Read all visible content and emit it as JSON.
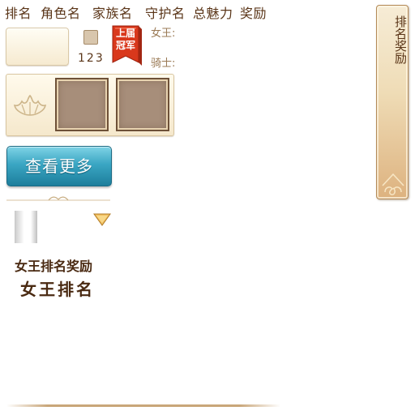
{
  "header": {
    "col_rank": "排名",
    "col_role": "角色名",
    "col_family": "家族名",
    "col_guard": "守护名",
    "col_charm": "总魅力",
    "col_reward": "奖励"
  },
  "entry": {
    "number": "123",
    "badge_text": "上届冠军",
    "queen_label": "女王:",
    "knight_label": "骑士:"
  },
  "buttons": {
    "more_label": "查看更多"
  },
  "section": {
    "reward_title": "女王排名奖励",
    "rank_title": "女王排名"
  },
  "side_tab": {
    "label": "排名奖励"
  },
  "colors": {
    "badge_red": "#d9381c",
    "button_teal": "#3aa6c3",
    "text_brown": "#5a3518"
  },
  "icons": [
    "fan-emblem-icon",
    "chevron-down-icon",
    "cloud-ornament-icon"
  ]
}
